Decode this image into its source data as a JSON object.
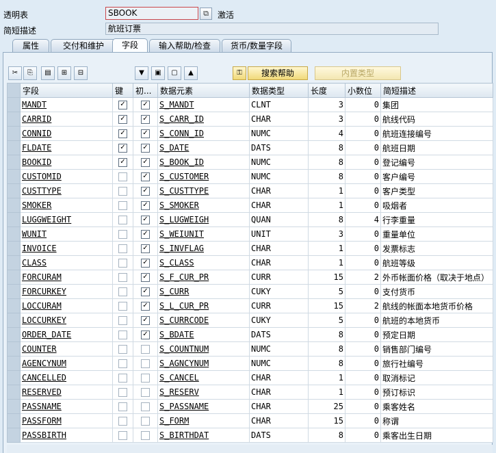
{
  "header": {
    "table_label": "透明表",
    "table_name": "SBOOK",
    "status": "激活",
    "desc_label": "简短描述",
    "desc_value": "航班订票"
  },
  "tabs": [
    {
      "label": "属性",
      "active": false
    },
    {
      "label": "交付和维护",
      "active": false
    },
    {
      "label": "字段",
      "active": true
    },
    {
      "label": "输入帮助/检查",
      "active": false
    },
    {
      "label": "货币/数量字段",
      "active": false
    }
  ],
  "toolbar": {
    "search_help_label": "搜索帮助",
    "builtin_type_label": "内置类型"
  },
  "columns": [
    "字段",
    "键",
    "初...",
    "数据元素",
    "数据类型",
    "长度",
    "小数位",
    "简短描述"
  ],
  "rows": [
    {
      "field": "MANDT",
      "key": true,
      "init": true,
      "element": "S_MANDT",
      "type": "CLNT",
      "length": "3",
      "decimals": "0",
      "desc": "集团"
    },
    {
      "field": "CARRID",
      "key": true,
      "init": true,
      "element": "S_CARR_ID",
      "type": "CHAR",
      "length": "3",
      "decimals": "0",
      "desc": "航线代码"
    },
    {
      "field": "CONNID",
      "key": true,
      "init": true,
      "element": "S_CONN_ID",
      "type": "NUMC",
      "length": "4",
      "decimals": "0",
      "desc": "航班连接编号"
    },
    {
      "field": "FLDATE",
      "key": true,
      "init": true,
      "element": "S_DATE",
      "type": "DATS",
      "length": "8",
      "decimals": "0",
      "desc": "航班日期"
    },
    {
      "field": "BOOKID",
      "key": true,
      "init": true,
      "element": "S_BOOK_ID",
      "type": "NUMC",
      "length": "8",
      "decimals": "0",
      "desc": "登记编号"
    },
    {
      "field": "CUSTOMID",
      "key": false,
      "init": true,
      "element": "S_CUSTOMER",
      "type": "NUMC",
      "length": "8",
      "decimals": "0",
      "desc": "客户编号"
    },
    {
      "field": "CUSTTYPE",
      "key": false,
      "init": true,
      "element": "S_CUSTTYPE",
      "type": "CHAR",
      "length": "1",
      "decimals": "0",
      "desc": "客户类型"
    },
    {
      "field": "SMOKER",
      "key": false,
      "init": true,
      "element": "S_SMOKER",
      "type": "CHAR",
      "length": "1",
      "decimals": "0",
      "desc": "吸烟者"
    },
    {
      "field": "LUGGWEIGHT",
      "key": false,
      "init": true,
      "element": "S_LUGWEIGH",
      "type": "QUAN",
      "length": "8",
      "decimals": "4",
      "desc": "行李重量"
    },
    {
      "field": "WUNIT",
      "key": false,
      "init": true,
      "element": "S_WEIUNIT",
      "type": "UNIT",
      "length": "3",
      "decimals": "0",
      "desc": "重量单位"
    },
    {
      "field": "INVOICE",
      "key": false,
      "init": true,
      "element": "S_INVFLAG",
      "type": "CHAR",
      "length": "1",
      "decimals": "0",
      "desc": "发票标志"
    },
    {
      "field": "CLASS",
      "key": false,
      "init": true,
      "element": "S_CLASS",
      "type": "CHAR",
      "length": "1",
      "decimals": "0",
      "desc": "航班等级"
    },
    {
      "field": "FORCURAM",
      "key": false,
      "init": true,
      "element": "S_F_CUR_PR",
      "type": "CURR",
      "length": "15",
      "decimals": "2",
      "desc": "外币帐面价格（取决于地点）"
    },
    {
      "field": "FORCURKEY",
      "key": false,
      "init": true,
      "element": "S_CURR",
      "type": "CUKY",
      "length": "5",
      "decimals": "0",
      "desc": "支付货币"
    },
    {
      "field": "LOCCURAM",
      "key": false,
      "init": true,
      "element": "S_L_CUR_PR",
      "type": "CURR",
      "length": "15",
      "decimals": "2",
      "desc": "航线的帐面本地货币价格"
    },
    {
      "field": "LOCCURKEY",
      "key": false,
      "init": true,
      "element": "S_CURRCODE",
      "type": "CUKY",
      "length": "5",
      "decimals": "0",
      "desc": "航班的本地货币"
    },
    {
      "field": "ORDER_DATE",
      "key": false,
      "init": true,
      "element": "S_BDATE",
      "type": "DATS",
      "length": "8",
      "decimals": "0",
      "desc": "预定日期"
    },
    {
      "field": "COUNTER",
      "key": false,
      "init": false,
      "element": "S_COUNTNUM",
      "type": "NUMC",
      "length": "8",
      "decimals": "0",
      "desc": "销售部门编号"
    },
    {
      "field": "AGENCYNUM",
      "key": false,
      "init": false,
      "element": "S_AGNCYNUM",
      "type": "NUMC",
      "length": "8",
      "decimals": "0",
      "desc": "旅行社编号"
    },
    {
      "field": "CANCELLED",
      "key": false,
      "init": false,
      "element": "S_CANCEL",
      "type": "CHAR",
      "length": "1",
      "decimals": "0",
      "desc": "取消标记"
    },
    {
      "field": "RESERVED",
      "key": false,
      "init": false,
      "element": "S_RESERV",
      "type": "CHAR",
      "length": "1",
      "decimals": "0",
      "desc": "预订标识"
    },
    {
      "field": "PASSNAME",
      "key": false,
      "init": false,
      "element": "S_PASSNAME",
      "type": "CHAR",
      "length": "25",
      "decimals": "0",
      "desc": "乘客姓名"
    },
    {
      "field": "PASSFORM",
      "key": false,
      "init": false,
      "element": "S_FORM",
      "type": "CHAR",
      "length": "15",
      "decimals": "0",
      "desc": "称谓"
    },
    {
      "field": "PASSBIRTH",
      "key": false,
      "init": false,
      "element": "S_BIRTHDAT",
      "type": "DATS",
      "length": "8",
      "decimals": "0",
      "desc": "乘客出生日期"
    }
  ]
}
